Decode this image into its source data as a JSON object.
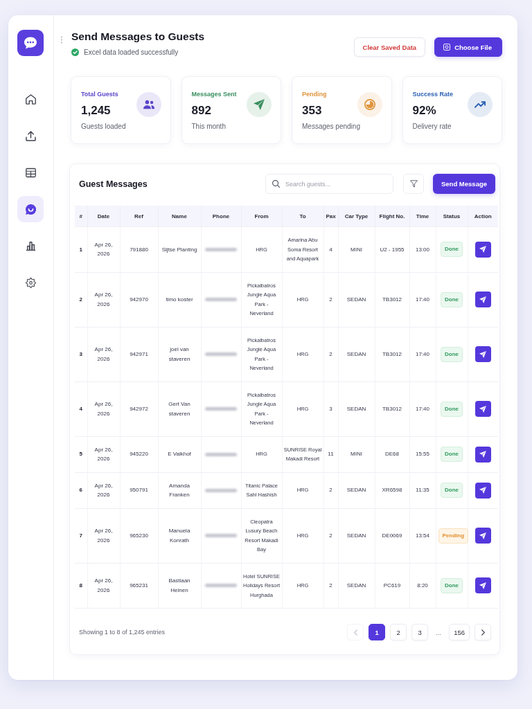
{
  "sidebar": {
    "items": [
      {
        "kind": "home",
        "selected": false
      },
      {
        "kind": "upload",
        "selected": false
      },
      {
        "kind": "table",
        "selected": false
      },
      {
        "kind": "chat",
        "selected": true
      },
      {
        "kind": "chart",
        "selected": false
      },
      {
        "kind": "settings",
        "selected": false
      }
    ]
  },
  "header": {
    "title": "Send Messages to Guests",
    "status": "Excel data loaded successfully",
    "buttons": [
      {
        "label": "Clear Saved Data",
        "kind": "clear"
      },
      {
        "label": "Choose File",
        "kind": "upload"
      }
    ]
  },
  "stats": [
    {
      "kind": "guests",
      "label": "Total Guests",
      "value": "1,245",
      "note": "Guests loaded",
      "color": "#5a45c8"
    },
    {
      "kind": "sent",
      "label": "Messages Sent",
      "value": "892",
      "note": "This month",
      "color": "#3a8f5f"
    },
    {
      "kind": "pending",
      "label": "Pending",
      "value": "353",
      "note": "Messages pending",
      "color": "#e0953e"
    },
    {
      "kind": "rate",
      "label": "Success Rate",
      "value": "92%",
      "note": "Delivery rate",
      "color": "#2d62b4"
    }
  ],
  "table": {
    "title": "Guest Messages",
    "search": {
      "placeholder": "Search guests..."
    },
    "send_button": "Send Message",
    "columns": [
      "#",
      "Date",
      "Ref",
      "Name",
      "Phone",
      "From",
      "To",
      "Pax",
      "Car Type",
      "Flight No.",
      "Time",
      "Status",
      "Action"
    ],
    "rows": [
      {
        "num": "1",
        "date": "Apr 26, 2026",
        "ref": "791880",
        "name": "Sijtse Planting",
        "phone_redacted": true,
        "from": "HRG",
        "to": "Amarina Abu Soma Resort and Aquapark",
        "pax": "4",
        "car_type": "MINI",
        "flight": "U2 - 1955",
        "time": "13:00",
        "status": {
          "label": "Done",
          "kind": "done"
        }
      },
      {
        "num": "2",
        "date": "Apr 26, 2026",
        "ref": "942970",
        "name": "timo koster",
        "phone_redacted": true,
        "from": "Pickalbatros Jungle Aqua Park - Neverland",
        "to": "HRG",
        "pax": "2",
        "car_type": "SEDAN",
        "flight": "TB3012",
        "time": "17:40",
        "status": {
          "label": "Done",
          "kind": "done"
        }
      },
      {
        "num": "3",
        "date": "Apr 26, 2026",
        "ref": "942971",
        "name": "joel van staveren",
        "phone_redacted": true,
        "from": "Pickalbatros Jungle Aqua Park - Neverland",
        "to": "HRG",
        "pax": "2",
        "car_type": "SEDAN",
        "flight": "TB3012",
        "time": "17:40",
        "status": {
          "label": "Done",
          "kind": "done"
        }
      },
      {
        "num": "4",
        "date": "Apr 26, 2026",
        "ref": "942972",
        "name": "Gert Van staveren",
        "phone_redacted": true,
        "from": "Pickalbatros Jungle Aqua Park - Neverland",
        "to": "HRG",
        "pax": "3",
        "car_type": "SEDAN",
        "flight": "TB3012",
        "time": "17:40",
        "status": {
          "label": "Done",
          "kind": "done"
        }
      },
      {
        "num": "5",
        "date": "Apr 26, 2026",
        "ref": "945220",
        "name": "E Valkhof",
        "phone_redacted": true,
        "from": "HRG",
        "to": "SUNRISE Royal Makadi Resort",
        "pax": "11",
        "car_type": "MINI",
        "flight": "DE68",
        "time": "15:55",
        "status": {
          "label": "Done",
          "kind": "done"
        }
      },
      {
        "num": "6",
        "date": "Apr 26, 2026",
        "ref": "950791",
        "name": "Amanda Franken",
        "phone_redacted": true,
        "from": "Titanic Palace Sahl Hashish",
        "to": "HRG",
        "pax": "2",
        "car_type": "SEDAN",
        "flight": "XR6598",
        "time": "11:35",
        "status": {
          "label": "Done",
          "kind": "done"
        }
      },
      {
        "num": "7",
        "date": "Apr 26, 2026",
        "ref": "965230",
        "name": "Manuela Konrath",
        "phone_redacted": true,
        "from": "Cleopatra Lusury Beach Resort Makadi Bay",
        "to": "HRG",
        "pax": "2",
        "car_type": "SEDAN",
        "flight": "DE0069",
        "time": "13:54",
        "status": {
          "label": "Pending",
          "kind": "pending"
        }
      },
      {
        "num": "8",
        "date": "Apr 26, 2026",
        "ref": "965231",
        "name": "Bastiaan Heinen",
        "phone_redacted": true,
        "from": "Hotel SUNRISE Holidays Resort Hurghada",
        "to": "HRG",
        "pax": "2",
        "car_type": "SEDAN",
        "flight": "PC619",
        "time": "8:20",
        "status": {
          "label": "Done",
          "kind": "done"
        }
      }
    ],
    "pagination": {
      "summary": "Showing 1 to 8 of 1,245 entries",
      "prev": {
        "disabled": true
      },
      "pages": [
        {
          "label": "1",
          "selected": true
        },
        {
          "label": "2",
          "selected": false
        },
        {
          "label": "3",
          "selected": false
        }
      ],
      "ellipsis": "...",
      "last": {
        "label": "156",
        "selected": false
      },
      "next": {
        "disabled": false
      }
    }
  }
}
